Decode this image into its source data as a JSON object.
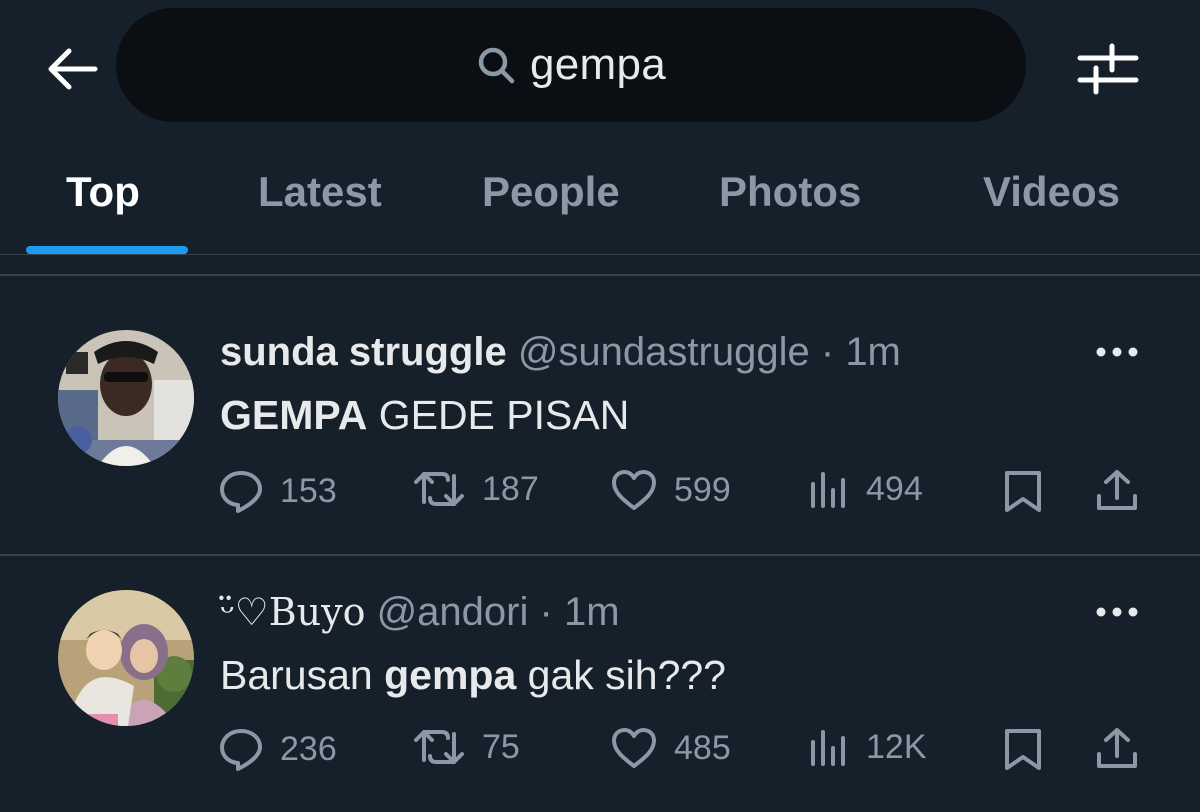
{
  "search": {
    "query": "gempa"
  },
  "tabs": [
    {
      "label": "Top",
      "active": true
    },
    {
      "label": "Latest"
    },
    {
      "label": "People"
    },
    {
      "label": "Photos"
    },
    {
      "label": "Videos"
    }
  ],
  "colors": {
    "accent": "#1d9bf0",
    "background": "#15202b",
    "search_bg": "#0b0f14",
    "muted": "#8b98a5"
  },
  "icons": [
    "back-arrow-icon",
    "search-icon",
    "filter-sliders-icon",
    "more-icon",
    "reply-icon",
    "retweet-icon",
    "like-icon",
    "views-icon",
    "bookmark-icon",
    "share-icon"
  ],
  "tweets": [
    {
      "display_name": "sunda struggle",
      "handle": "@sundastruggle",
      "dot": "·",
      "time": "1m",
      "text_bold": "GEMPA",
      "text_rest": " GEDE PISAN",
      "replies": "153",
      "retweets": "187",
      "likes": "599",
      "views": "494"
    },
    {
      "display_name": "ᵕ̈♡Buyo",
      "handle": "@andori",
      "dot": "·",
      "time": "1m",
      "text_pre": "Barusan ",
      "text_bold": "gempa",
      "text_post": " gak sih???",
      "replies": "236",
      "retweets": "75",
      "likes": "485",
      "views": "12K"
    }
  ]
}
